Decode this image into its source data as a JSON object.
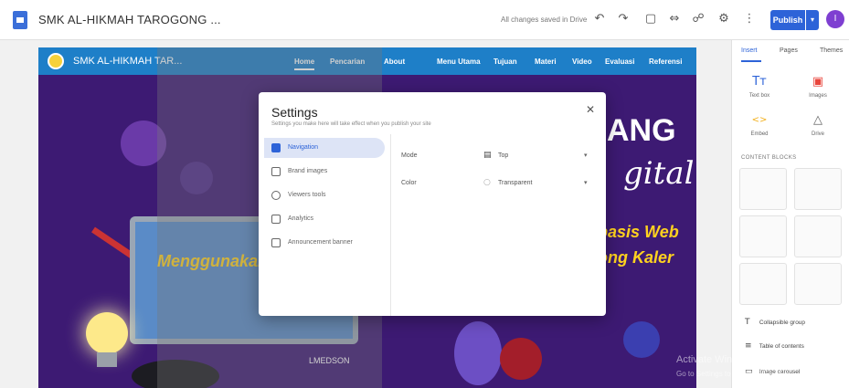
{
  "topbar": {
    "site_title": "SMK AL-HIKMAH TAROGONG ...",
    "saved_text": "All changes saved in Drive",
    "publish_label": "Publish",
    "avatar_letter": "I"
  },
  "site": {
    "name": "SMK AL-HIKMAH TAR...",
    "nav": [
      "Home",
      "Pencarian",
      "About",
      "Menu Utama",
      "Tujuan",
      "Materi",
      "Video",
      "Evaluasi",
      "Referensi"
    ],
    "hero": {
      "big_text": "ANG",
      "script_text": "gital",
      "yellow_left": "Menggunakan",
      "yellow_right_1": "basis Web",
      "yellow_right_2": "ong Kaler",
      "bottom_label": "LMEDSON"
    }
  },
  "settings": {
    "title": "Settings",
    "subtitle": "Settings you make here will take effect when you publish your site",
    "sidebar": [
      "Navigation",
      "Brand images",
      "Viewers tools",
      "Analytics",
      "Announcement banner"
    ],
    "fields": [
      {
        "label": "Mode",
        "value": "Top",
        "icon": "layout-top-icon"
      },
      {
        "label": "Color",
        "value": "Transparent",
        "icon": "color-circle-icon"
      }
    ]
  },
  "right_panel": {
    "tabs": [
      "Insert",
      "Pages",
      "Themes"
    ],
    "tools": [
      {
        "label": "Text box",
        "icon": "Tт"
      },
      {
        "label": "Images",
        "icon": "▣"
      },
      {
        "label": "Embed",
        "icon": "<>"
      },
      {
        "label": "Drive",
        "icon": "△"
      }
    ],
    "section": "CONTENT BLOCKS",
    "actions": [
      {
        "label": "Collapsible group",
        "icon": "T"
      },
      {
        "label": "Table of contents",
        "icon": "≡"
      },
      {
        "label": "Image carousel",
        "icon": "▭"
      }
    ]
  },
  "watermark": {
    "line1": "Activate Windows",
    "line2": "Go to Settings to activate Windows."
  }
}
